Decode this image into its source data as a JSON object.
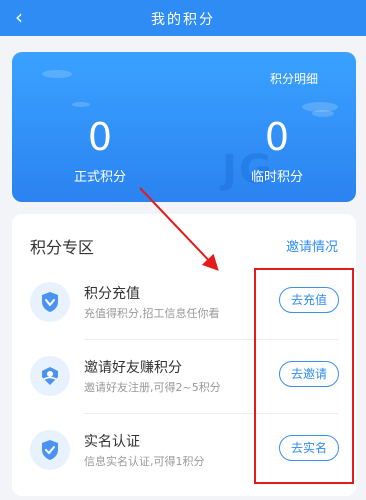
{
  "header": {
    "title": "我的积分"
  },
  "hero": {
    "detail_link": "积分明细",
    "watermark": "JG",
    "formal": {
      "value": "0",
      "label": "正式积分"
    },
    "temporary": {
      "value": "0",
      "label": "临时积分"
    }
  },
  "zone": {
    "title": "积分专区",
    "invite_status_link": "邀请情况",
    "items": [
      {
        "name": "积分充值",
        "desc": "充值得积分,招工信息任你看",
        "button": "去充值"
      },
      {
        "name": "邀请好友赚积分",
        "desc": "邀请好友注册,可得2~5积分",
        "button": "去邀请"
      },
      {
        "name": "实名认证",
        "desc": "信息实名认证,可得1积分",
        "button": "去实名"
      }
    ]
  },
  "colors": {
    "primary": "#2f8cf5",
    "annotation": "#e31b1b"
  }
}
